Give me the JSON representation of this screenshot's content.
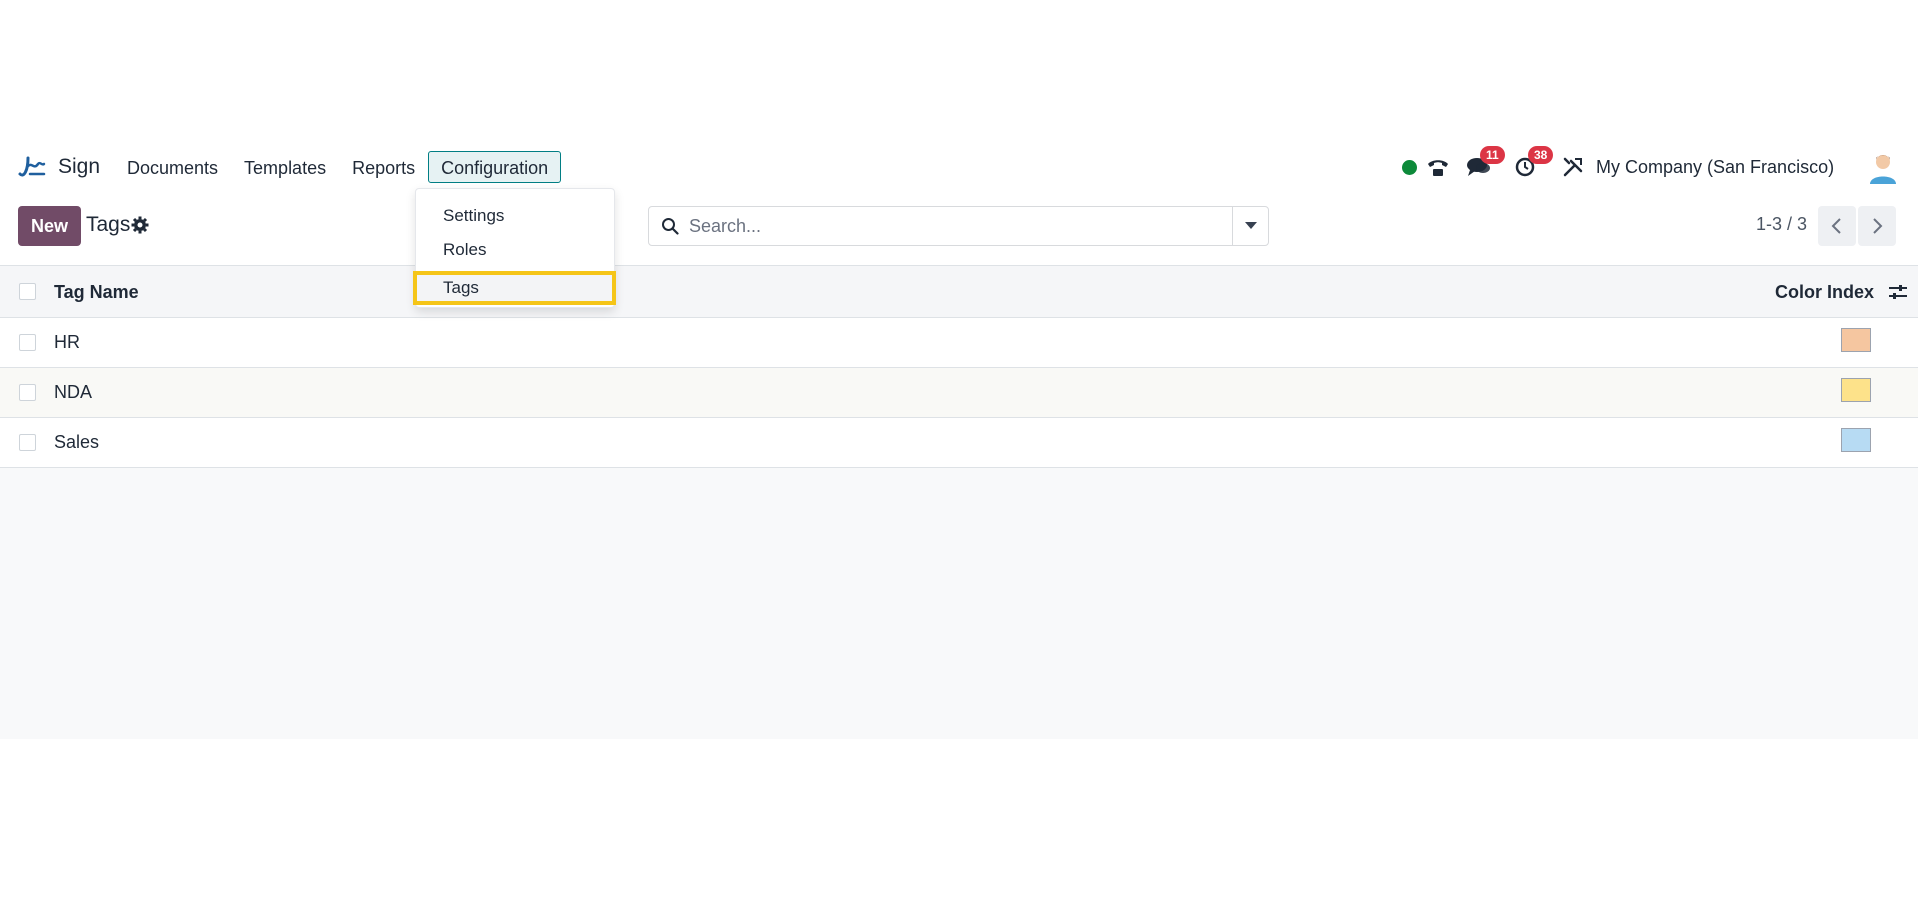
{
  "navbar": {
    "app_name": "Sign",
    "menu": [
      {
        "label": "Documents"
      },
      {
        "label": "Templates"
      },
      {
        "label": "Reports"
      },
      {
        "label": "Configuration",
        "active": true
      }
    ],
    "messages_count": "11",
    "activities_count": "38",
    "company": "My Company (San Francisco)",
    "icons": [
      "sign-logo-icon",
      "presence-icon",
      "phone-icon",
      "chat-icon",
      "clock-icon",
      "tools-icon",
      "avatar"
    ]
  },
  "control_panel": {
    "new_label": "New",
    "title": "Tags",
    "search_placeholder": "Search...",
    "pager": "1-3 / 3"
  },
  "dropdown": {
    "items": [
      {
        "label": "Settings"
      },
      {
        "label": "Roles"
      },
      {
        "label": "Tags",
        "highlighted": true
      }
    ]
  },
  "list": {
    "columns": [
      "Tag Name",
      "Color Index"
    ],
    "rows": [
      {
        "name": "HR",
        "color": "#f5c6a0"
      },
      {
        "name": "NDA",
        "color": "#fde28a"
      },
      {
        "name": "Sales",
        "color": "#b7dbf3"
      }
    ]
  },
  "colors": {
    "brand": "#714b67",
    "accent": "#017e84",
    "badge": "#dc3545",
    "highlight": "#f5c518"
  }
}
